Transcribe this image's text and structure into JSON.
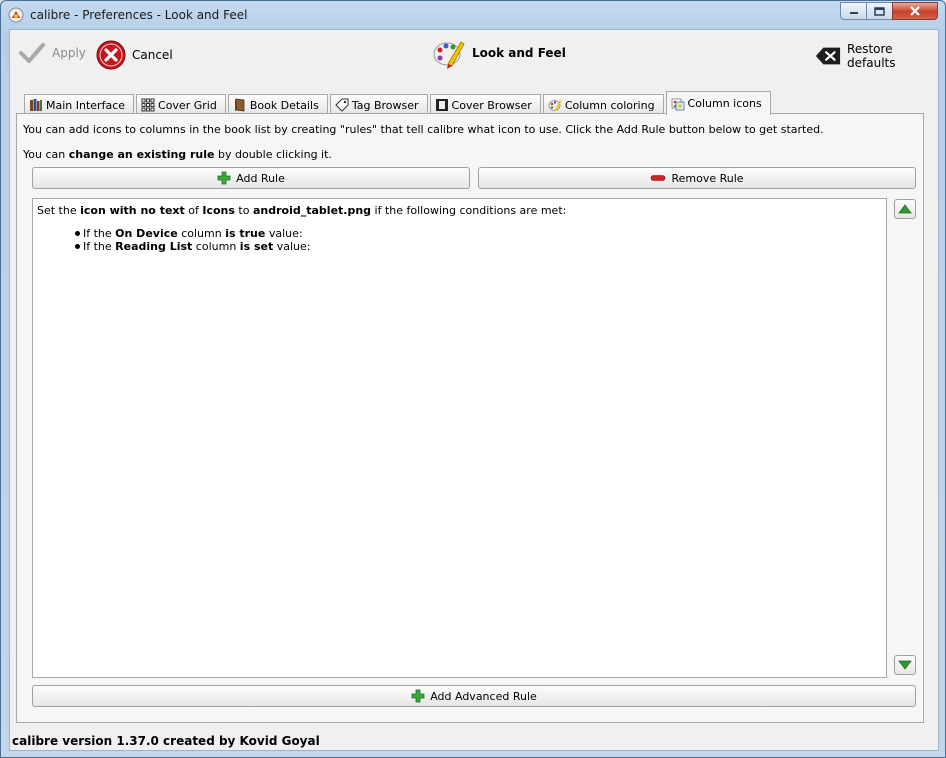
{
  "window": {
    "title": "calibre - Preferences - Look and Feel"
  },
  "toolbar": {
    "apply_label": "Apply",
    "cancel_label": "Cancel",
    "section_title": "Look and Feel",
    "restore_label": "Restore defaults"
  },
  "tabs": [
    {
      "label": "Main Interface",
      "icon": "books-icon",
      "active": false
    },
    {
      "label": "Cover Grid",
      "icon": "grid-icon",
      "active": false
    },
    {
      "label": "Book Details",
      "icon": "book-icon",
      "active": false
    },
    {
      "label": "Tag Browser",
      "icon": "tag-icon",
      "active": false
    },
    {
      "label": "Cover Browser",
      "icon": "cover-icon",
      "active": false
    },
    {
      "label": "Column coloring",
      "icon": "palette-icon",
      "active": false
    },
    {
      "label": "Column icons",
      "icon": "image-icon",
      "active": true
    }
  ],
  "content": {
    "info_line1": "You can add icons to columns in the book list by creating \"rules\" that tell calibre what icon to use. Click the Add Rule button below to get started.",
    "info_line2_pre": "You can ",
    "info_line2_bold": "change an existing rule",
    "info_line2_post": " by double clicking it.",
    "add_rule_label": "Add Rule",
    "remove_rule_label": "Remove Rule",
    "add_advanced_rule_label": "Add Advanced Rule"
  },
  "rule": {
    "p1": "Set the ",
    "kind": "icon with no text",
    "p2": " of ",
    "column": "Icons",
    "p3": " to ",
    "icon_file": "android_tablet.png",
    "p4": " if the following conditions are met:",
    "conditions": [
      {
        "pre": "If the ",
        "column": "On Device",
        "mid": " column ",
        "op": "is true",
        "post": " value:"
      },
      {
        "pre": "If the ",
        "column": "Reading List",
        "mid": " column ",
        "op": "is set",
        "post": " value:"
      }
    ]
  },
  "status": {
    "version_text": "calibre version 1.37.0 created by Kovid Goyal"
  }
}
